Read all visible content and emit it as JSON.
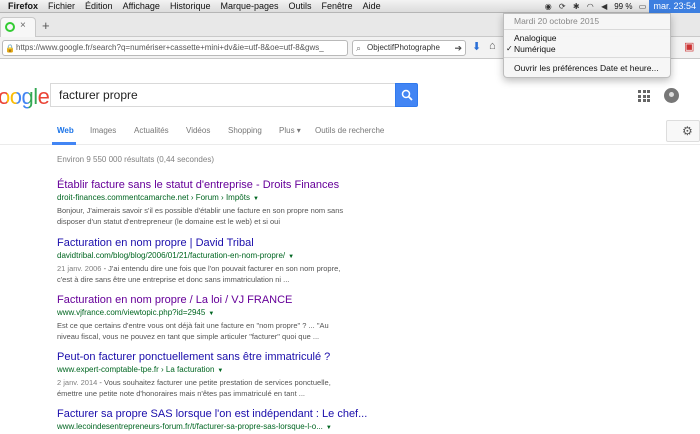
{
  "menubar": {
    "app": "Firefox",
    "items": [
      "Fichier",
      "Édition",
      "Affichage",
      "Historique",
      "Marque-pages",
      "Outils",
      "Fenêtre",
      "Aide"
    ],
    "battery": "99 %",
    "clock": "mar. 23:54"
  },
  "browser": {
    "url": "https://www.google.fr/search?q=numériser+cassette+mini+dv&ie=utf-8&oe=utf-8&gws_",
    "search_engine_text": "ObjectifPhotographe"
  },
  "clock_menu": {
    "date": "Mardi 20 octobre 2015",
    "options": [
      "Analogique",
      "Numérique"
    ],
    "checked": "Numérique",
    "preferences": "Ouvrir les préférences Date et heure..."
  },
  "google": {
    "logo": "oogle",
    "query": "facturer propre",
    "tabs": [
      "Web",
      "Images",
      "Actualités",
      "Vidéos",
      "Shopping",
      "Plus",
      "Outils de recherche"
    ],
    "active_tab": "Web",
    "stats": "Environ 9 550 000 résultats (0,44 secondes)"
  },
  "results": [
    {
      "title": "Établir facture sans le statut d'entreprise - Droits Finances",
      "url": "droit-finances.commentcamarche.net › Forum › Impôts",
      "snippet_1": "Bonjour, J'aimerais savoir s'il es possible d'établir une facture en son propre nom sans",
      "snippet_2": "disposer d'un statut d'entrepreneur (le domaine est le web) et si oui"
    },
    {
      "title": "Facturation en nom propre | David Tribal",
      "url": "davidtribal.com/blog/blog/2006/01/21/facturation-en-nom-propre/",
      "date": "21 janv. 2006",
      "snippet_1": "J'ai entendu dire une fois que l'on pouvait facturer en son nom propre,",
      "snippet_2": "c'est à dire sans être une entreprise et donc sans immatriculation ni ..."
    },
    {
      "title": "Facturation en nom propre / La loi / VJ FRANCE",
      "url": "www.vjfrance.com/viewtopic.php?id=2945",
      "snippet_1": "Est ce que certains d'entre vous ont déjà fait une facture en \"nom propre\" ? ... \"Au",
      "snippet_2": "niveau fiscal, vous ne pouvez en tant que simple articuler \"facturer\" quoi que ..."
    },
    {
      "title": "Peut-on facturer ponctuellement sans être immatriculé ?",
      "url": "www.expert-comptable-tpe.fr › La facturation",
      "date": "2 janv. 2014",
      "snippet_1": "Vous souhaitez facturer une petite prestation de services ponctuelle,",
      "snippet_2": "émettre une petite note d'honoraires mais n'êtes pas immatriculé en tant ..."
    },
    {
      "title": "Facturer sa propre SAS lorsque l'on est indépendant : Le chef...",
      "url": "www.lecoindesentrepreneurs-forum.fr/t/facturer-sa-propre-sas-lorsque-l-o..."
    }
  ]
}
